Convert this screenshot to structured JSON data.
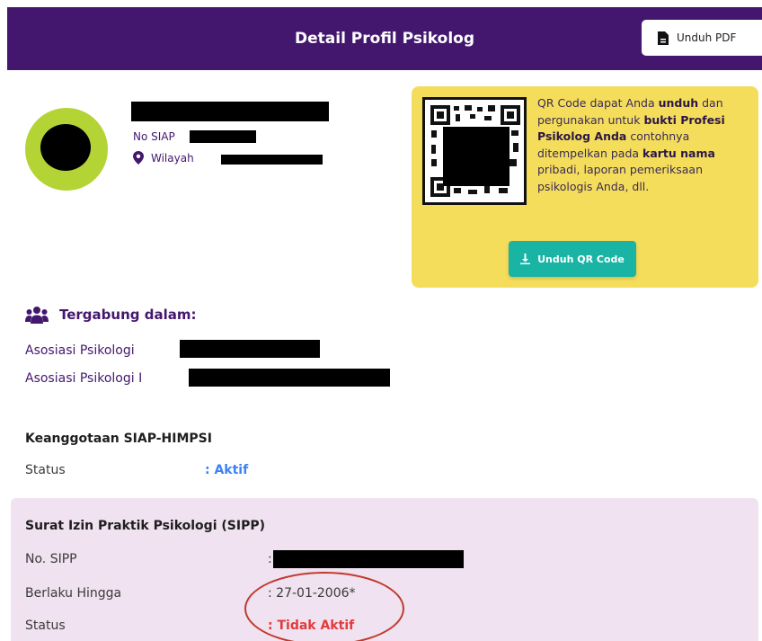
{
  "header": {
    "title": "Detail Profil Psikolog",
    "pdf_button": "Unduh PDF"
  },
  "profile": {
    "siap_label": "No SIAP",
    "region_label": "Wilayah"
  },
  "qr": {
    "text_html": "QR Code dapat Anda <b>unduh</b> dan pergunakan untuk <b>bukti Profesi Psikolog Anda</b> contohnya ditempelkan pada <b>kartu nama</b> pribadi, laporan pemeriksaan psikologis Anda, dll.",
    "download_button": "Unduh QR Code"
  },
  "joined": {
    "heading": "Tergabung dalam:",
    "associations": [
      "Asosiasi Psikologi",
      "Asosiasi Psikologi I"
    ]
  },
  "membership": {
    "title": "Keanggotaan SIAP-HIMPSI",
    "status_label": "Status",
    "status_value": ": Aktif"
  },
  "sipp": {
    "title": "Surat Izin Praktik Psikologi (SIPP)",
    "no_label": "No. SIPP",
    "no_value": ":",
    "valid_label": "Berlaku Hingga",
    "valid_value": ": 27-01-2006*",
    "status_label": "Status",
    "status_value": ": Tidak Aktif"
  },
  "colors": {
    "header_bg": "#43176e",
    "avatar_ring": "#b4d335",
    "qr_card_bg": "#f5dd5c",
    "qr_button_bg": "#1ab4a5",
    "sipp_bg": "#f0e2f0",
    "active": "#3b82f6",
    "inactive": "#e33b3b",
    "annotation_circle": "#c0392b"
  }
}
